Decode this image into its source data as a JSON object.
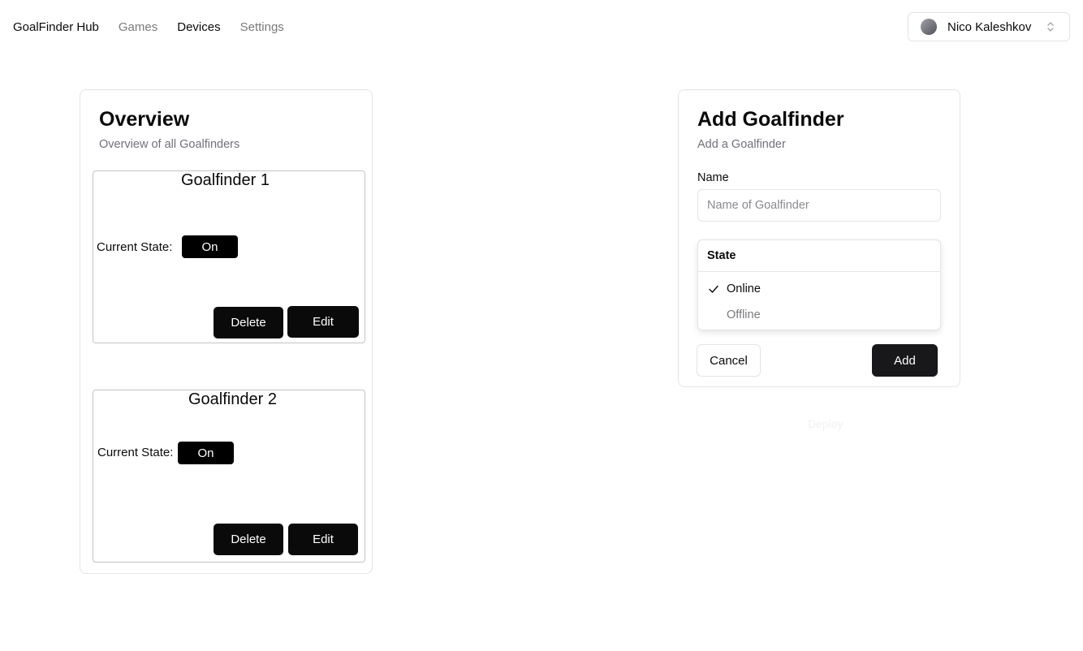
{
  "nav": {
    "brand": "GoalFinder Hub",
    "items": [
      {
        "label": "Games",
        "active": false
      },
      {
        "label": "Devices",
        "active": true
      },
      {
        "label": "Settings",
        "active": false
      }
    ]
  },
  "user": {
    "name": "Nico Kaleshkov",
    "avatar_icon": "avatar-circle",
    "switch_icon": "chevron-up-down-icon"
  },
  "overview": {
    "title": "Overview",
    "subtitle": "Overview of all Goalfinders",
    "devices": [
      {
        "name": "Goalfinder 1",
        "state_label": "Current State:",
        "state": "On",
        "delete_label": "Delete",
        "edit_label": "Edit"
      },
      {
        "name": "Goalfinder 2",
        "state_label": "Current State:",
        "state": "On",
        "delete_label": "Delete",
        "edit_label": "Edit"
      }
    ]
  },
  "add_form": {
    "title": "Add Goalfinder",
    "subtitle": "Add a Goalfinder",
    "name_label": "Name",
    "name_value": "",
    "name_placeholder": "Name of Goalfinder",
    "state_dropdown": {
      "header": "State",
      "options": [
        {
          "label": "Online",
          "selected": true
        },
        {
          "label": "Offline",
          "selected": false
        }
      ]
    },
    "cancel_label": "Cancel",
    "add_label": "Add",
    "faded_text": "Deploy"
  },
  "colors": {
    "primary": "#0a0a0a",
    "muted": "#71717a",
    "border": "#e4e4e7",
    "pill": "#000000"
  }
}
